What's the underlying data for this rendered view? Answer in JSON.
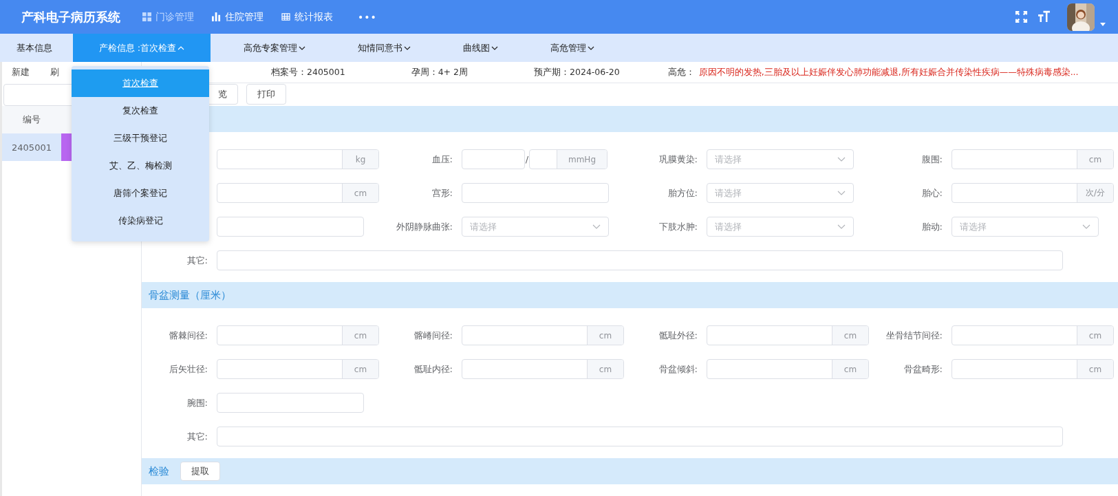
{
  "header": {
    "title": "产科电子病历系统",
    "nav": [
      {
        "label": "门诊管理",
        "selected": true
      },
      {
        "label": "住院管理",
        "selected": false
      },
      {
        "label": "统计报表",
        "selected": false
      }
    ],
    "more": "•••"
  },
  "tabs": [
    {
      "label": "基本信息",
      "selected": false
    },
    {
      "label": "产检信息 :首次检查",
      "selected": true,
      "expanded": true
    },
    {
      "label": "高危专案管理",
      "selected": false,
      "expanded": false
    },
    {
      "label": "知情同意书",
      "selected": false,
      "expanded": false
    },
    {
      "label": "曲线图",
      "selected": false,
      "expanded": false
    },
    {
      "label": "高危管理",
      "selected": false,
      "expanded": false
    }
  ],
  "dropdown": [
    {
      "label": "首次检查",
      "selected": true
    },
    {
      "label": "复次检查",
      "selected": false
    },
    {
      "label": "三级干预登记",
      "selected": false
    },
    {
      "label": "艾、乙、梅检测",
      "selected": false
    },
    {
      "label": "唐筛个案登记",
      "selected": false
    },
    {
      "label": "传染病登记",
      "selected": false
    }
  ],
  "sidebar": {
    "actions": [
      "新建",
      "刷"
    ],
    "columns": [
      "编号"
    ],
    "rows": [
      {
        "id": "2405001",
        "selected": true,
        "color": "#b866f0"
      }
    ]
  },
  "patient": {
    "fields": [
      {
        "label": "档案号：",
        "value": "2405001"
      },
      {
        "label": "孕周：",
        "value": "4+ 2周"
      },
      {
        "label": "预产期：",
        "value": "2024-06-20"
      }
    ],
    "risk_label": "高危：",
    "risk": "原因不明的发热,三胎及以上妊娠伴发心肺功能减退,所有妊娠合并传染性疾病——特殊病毒感染..."
  },
  "buttons": [
    "览",
    "打印"
  ],
  "sections": [
    {
      "rows": [
        [
          {
            "kind": "unit",
            "unit": "kg"
          },
          {
            "kind": "split",
            "label": "血压:",
            "sep": "/",
            "unit": "mmHg"
          },
          {
            "kind": "select",
            "label": "巩膜黄染:",
            "placeholder": "请选择"
          },
          {
            "kind": "unit",
            "label": "腹围:",
            "unit": "cm"
          }
        ],
        [
          {
            "kind": "unit",
            "unit": "cm"
          },
          {
            "kind": "text",
            "label": "宫形:"
          },
          {
            "kind": "select",
            "label": "胎方位:",
            "placeholder": "请选择"
          },
          {
            "kind": "unit",
            "label": "胎心:",
            "unit": "次/分"
          }
        ],
        [
          {
            "kind": "text"
          },
          {
            "kind": "select",
            "label": "外阴静脉曲张:",
            "placeholder": "请选择"
          },
          {
            "kind": "select",
            "label": "下肢水肿:",
            "placeholder": "请选择"
          },
          {
            "kind": "select",
            "label": "胎动:",
            "placeholder": "请选择"
          }
        ],
        [
          {
            "kind": "wide",
            "label": "其它:"
          }
        ]
      ]
    },
    {
      "title": "骨盆测量（厘米）",
      "rows": [
        [
          {
            "kind": "unit",
            "label": "髂棘间径:",
            "unit": "cm"
          },
          {
            "kind": "unit",
            "label": "髂嵴间径:",
            "unit": "cm"
          },
          {
            "kind": "unit",
            "label": "骶耻外径:",
            "unit": "cm"
          },
          {
            "kind": "unit",
            "label": "坐骨结节间径:",
            "unit": "cm"
          }
        ],
        [
          {
            "kind": "unit",
            "label": "后矢壮径:",
            "unit": "cm"
          },
          {
            "kind": "unit",
            "label": "骶耻内径:",
            "unit": "cm"
          },
          {
            "kind": "unit",
            "label": "骨盆倾斜:",
            "unit": "cm"
          },
          {
            "kind": "unit",
            "label": "骨盆畸形:",
            "unit": "cm"
          }
        ],
        [
          {
            "kind": "text",
            "label": "腕围:"
          }
        ],
        [
          {
            "kind": "wide",
            "label": "其它:"
          }
        ]
      ]
    },
    {
      "title": "检验",
      "button": "提取"
    }
  ]
}
